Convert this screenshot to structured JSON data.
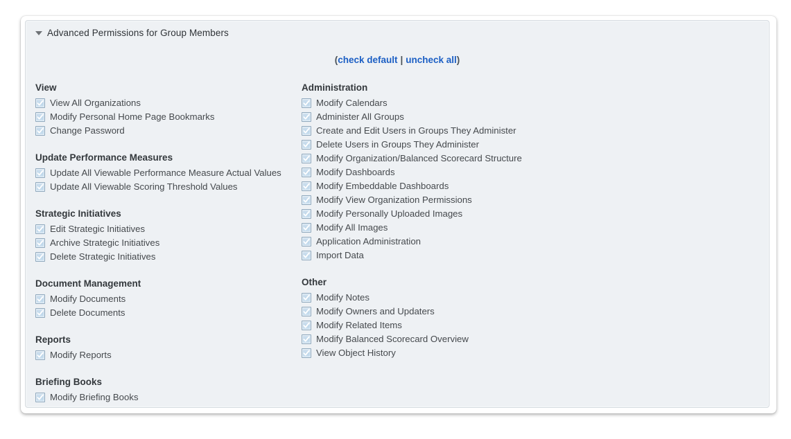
{
  "panel": {
    "title": "Advanced Permissions for Group Members",
    "twisty_icon": "chevron-down-icon",
    "expanded": true,
    "background_color": "#eef1f4",
    "border_color": "#d5dbe0"
  },
  "bulk_actions": {
    "open_paren": "(",
    "check_default_label": "check default",
    "separator": "|",
    "uncheck_all_label": "uncheck all",
    "close_paren": ")",
    "link_color": "#1c5fc4"
  },
  "checkbox": {
    "icon": "checkmark-icon",
    "checked": true,
    "fill_color": "#c6dcee",
    "border_color": "#8fa8bd",
    "check_color": "#ffffff"
  },
  "columns": {
    "left": [
      {
        "heading": "View",
        "items": [
          {
            "label": "View All Organizations",
            "checked": true
          },
          {
            "label": "Modify Personal Home Page Bookmarks",
            "checked": true
          },
          {
            "label": "Change Password",
            "checked": true
          }
        ]
      },
      {
        "heading": "Update Performance Measures",
        "items": [
          {
            "label": "Update All Viewable Performance Measure Actual Values",
            "checked": true
          },
          {
            "label": "Update All Viewable Scoring Threshold Values",
            "checked": true
          }
        ]
      },
      {
        "heading": "Strategic Initiatives",
        "items": [
          {
            "label": "Edit Strategic Initiatives",
            "checked": true
          },
          {
            "label": "Archive Strategic Initiatives",
            "checked": true
          },
          {
            "label": "Delete Strategic Initiatives",
            "checked": true
          }
        ]
      },
      {
        "heading": "Document Management",
        "items": [
          {
            "label": "Modify Documents",
            "checked": true
          },
          {
            "label": "Delete Documents",
            "checked": true
          }
        ]
      },
      {
        "heading": "Reports",
        "items": [
          {
            "label": "Modify Reports",
            "checked": true
          }
        ]
      },
      {
        "heading": "Briefing Books",
        "items": [
          {
            "label": "Modify Briefing Books",
            "checked": true
          }
        ]
      }
    ],
    "right": [
      {
        "heading": "Administration",
        "items": [
          {
            "label": "Modify Calendars",
            "checked": true
          },
          {
            "label": "Administer All Groups",
            "checked": true
          },
          {
            "label": "Create and Edit Users in Groups They Administer",
            "checked": true
          },
          {
            "label": "Delete Users in Groups They Administer",
            "checked": true
          },
          {
            "label": "Modify Organization/Balanced Scorecard Structure",
            "checked": true
          },
          {
            "label": "Modify Dashboards",
            "checked": true
          },
          {
            "label": "Modify Embeddable Dashboards",
            "checked": true
          },
          {
            "label": "Modify View Organization Permissions",
            "checked": true
          },
          {
            "label": "Modify Personally Uploaded Images",
            "checked": true
          },
          {
            "label": "Modify All Images",
            "checked": true
          },
          {
            "label": "Application Administration",
            "checked": true
          },
          {
            "label": "Import Data",
            "checked": true
          }
        ]
      },
      {
        "heading": "Other",
        "items": [
          {
            "label": "Modify Notes",
            "checked": true
          },
          {
            "label": "Modify Owners and Updaters",
            "checked": true
          },
          {
            "label": "Modify Related Items",
            "checked": true
          },
          {
            "label": "Modify Balanced Scorecard Overview",
            "checked": true
          },
          {
            "label": "View Object History",
            "checked": true
          }
        ]
      }
    ]
  }
}
